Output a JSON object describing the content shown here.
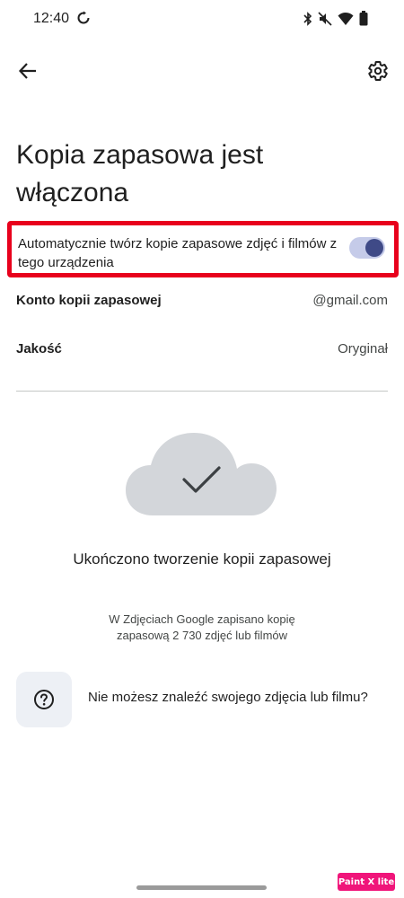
{
  "status_bar": {
    "time": "12:40",
    "icons": [
      "sync-icon",
      "bluetooth-icon",
      "mute-icon",
      "wifi-icon",
      "battery-icon"
    ]
  },
  "app_bar": {
    "back_icon": "arrow-back-icon",
    "settings_icon": "gear-icon"
  },
  "title": "Kopia zapasowa jest włączona",
  "auto_backup": {
    "label": "Automatycznie twórz kopie zapasowe zdjęć i filmów z tego urządzenia",
    "enabled": true,
    "highlight_color": "#e8001c",
    "switch_track_color": "#c5cbe9",
    "switch_thumb_color": "#3f4a87"
  },
  "settings_rows": [
    {
      "label": "Konto kopii zapasowej",
      "value": "@gmail.com"
    },
    {
      "label": "Jakość",
      "value": "Oryginał"
    }
  ],
  "status_section": {
    "illustration": "cloud-check-icon",
    "title": "Ukończono tworzenie kopii zapasowej",
    "description": "W Zdjęciach Google zapisano kopię zapasową 2 730 zdjęć lub filmów"
  },
  "help": {
    "icon": "help-circle-icon",
    "text": "Nie możesz znaleźć swojego zdjęcia lub filmu?"
  },
  "watermark": "Paint X lite"
}
